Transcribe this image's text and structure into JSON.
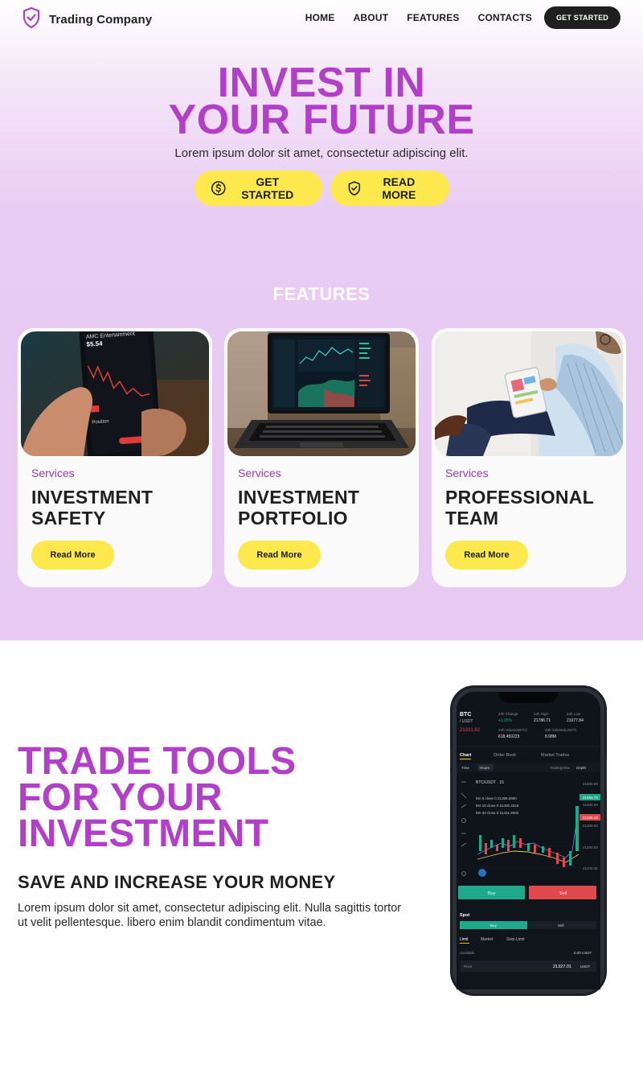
{
  "brand": {
    "name": "Trading Company",
    "logo_icon": "shield-check-icon",
    "accent": "#b23fc7"
  },
  "nav": {
    "items": [
      "HOME",
      "ABOUT",
      "FEATURES",
      "CONTACTS"
    ],
    "cta": "GET STARTED"
  },
  "hero": {
    "title": "INVEST IN\nYOUR FUTURE",
    "subtitle": "Lorem ipsum dolor sit amet, consectetur adipiscing elit.",
    "btn_primary": "GET STARTED",
    "btn_primary_icon": "dollar-circle-icon",
    "btn_secondary": "READ MORE",
    "btn_secondary_icon": "shield-check-icon",
    "button_color": "#fde84e"
  },
  "features": {
    "heading": "FEATURES",
    "cards": [
      {
        "kicker": "Services",
        "title": "INVESTMENT\nSAFETY",
        "button": "Read More",
        "photo": "phone-stock-app-photo"
      },
      {
        "kicker": "Services",
        "title": "INVESTMENT\nPORTFOLIO",
        "button": "Read More",
        "photo": "laptop-trading-chart-photo"
      },
      {
        "kicker": "Services",
        "title": "PROFESSIONAL\nTEAM",
        "button": "Read More",
        "photo": "man-with-tablet-photo"
      }
    ]
  },
  "tools": {
    "title": "TRADE TOOLS\nFOR YOUR\nINVESTMENT",
    "subtitle": "SAVE AND INCREASE YOUR MONEY",
    "body": "Lorem ipsum dolor sit amet, consectetur adipiscing elit. Nulla sagittis tortor ut velit pellentesque. libero enim blandit condimentum vitae."
  },
  "phone_app": {
    "pair": "BTC",
    "quote": "/ USDT",
    "price": "21331.82",
    "change_label": "24h Change",
    "change_value": "+1.05%",
    "high_label": "24h High",
    "high_value": "21786.71",
    "low_label": "24h Low",
    "low_value": "21077.84",
    "vol_btc_label": "24h Volume(BTC)",
    "vol_btc_value": "618.450223",
    "vol_usdt_label": "24h Volume(USDT)",
    "vol_usdt_value": "8.98M",
    "tabs": [
      "Chart",
      "Order Book",
      "Market Trades"
    ],
    "chart_tools": [
      "Time",
      "Hours"
    ],
    "chart_right": [
      "TradingView",
      "Depth"
    ],
    "pair_line": "BTC/USDT · 15",
    "ma5": "MA 5 close 0 21359.2960",
    "ma10": "MA 10 close 0 21400.4016",
    "ma30": "MA 30 close 0 21431.8000",
    "axis": [
      "21500.00",
      "21400.00",
      "21300.00",
      "21200.00",
      "21100.00"
    ],
    "tag_green": "21454.73",
    "tag_red": "21325.18",
    "buy": "Buy",
    "sell": "Sell",
    "spot": "Spot",
    "order_types": [
      "Limit",
      "Market",
      "Stop-Limit"
    ],
    "available_label": "Available",
    "available_value": "0.00 USDT",
    "price_label": "Price",
    "price_input": "21327.01",
    "price_unit": "USDT",
    "buy_color": "#1fa88a",
    "sell_color": "#e04a4f"
  }
}
